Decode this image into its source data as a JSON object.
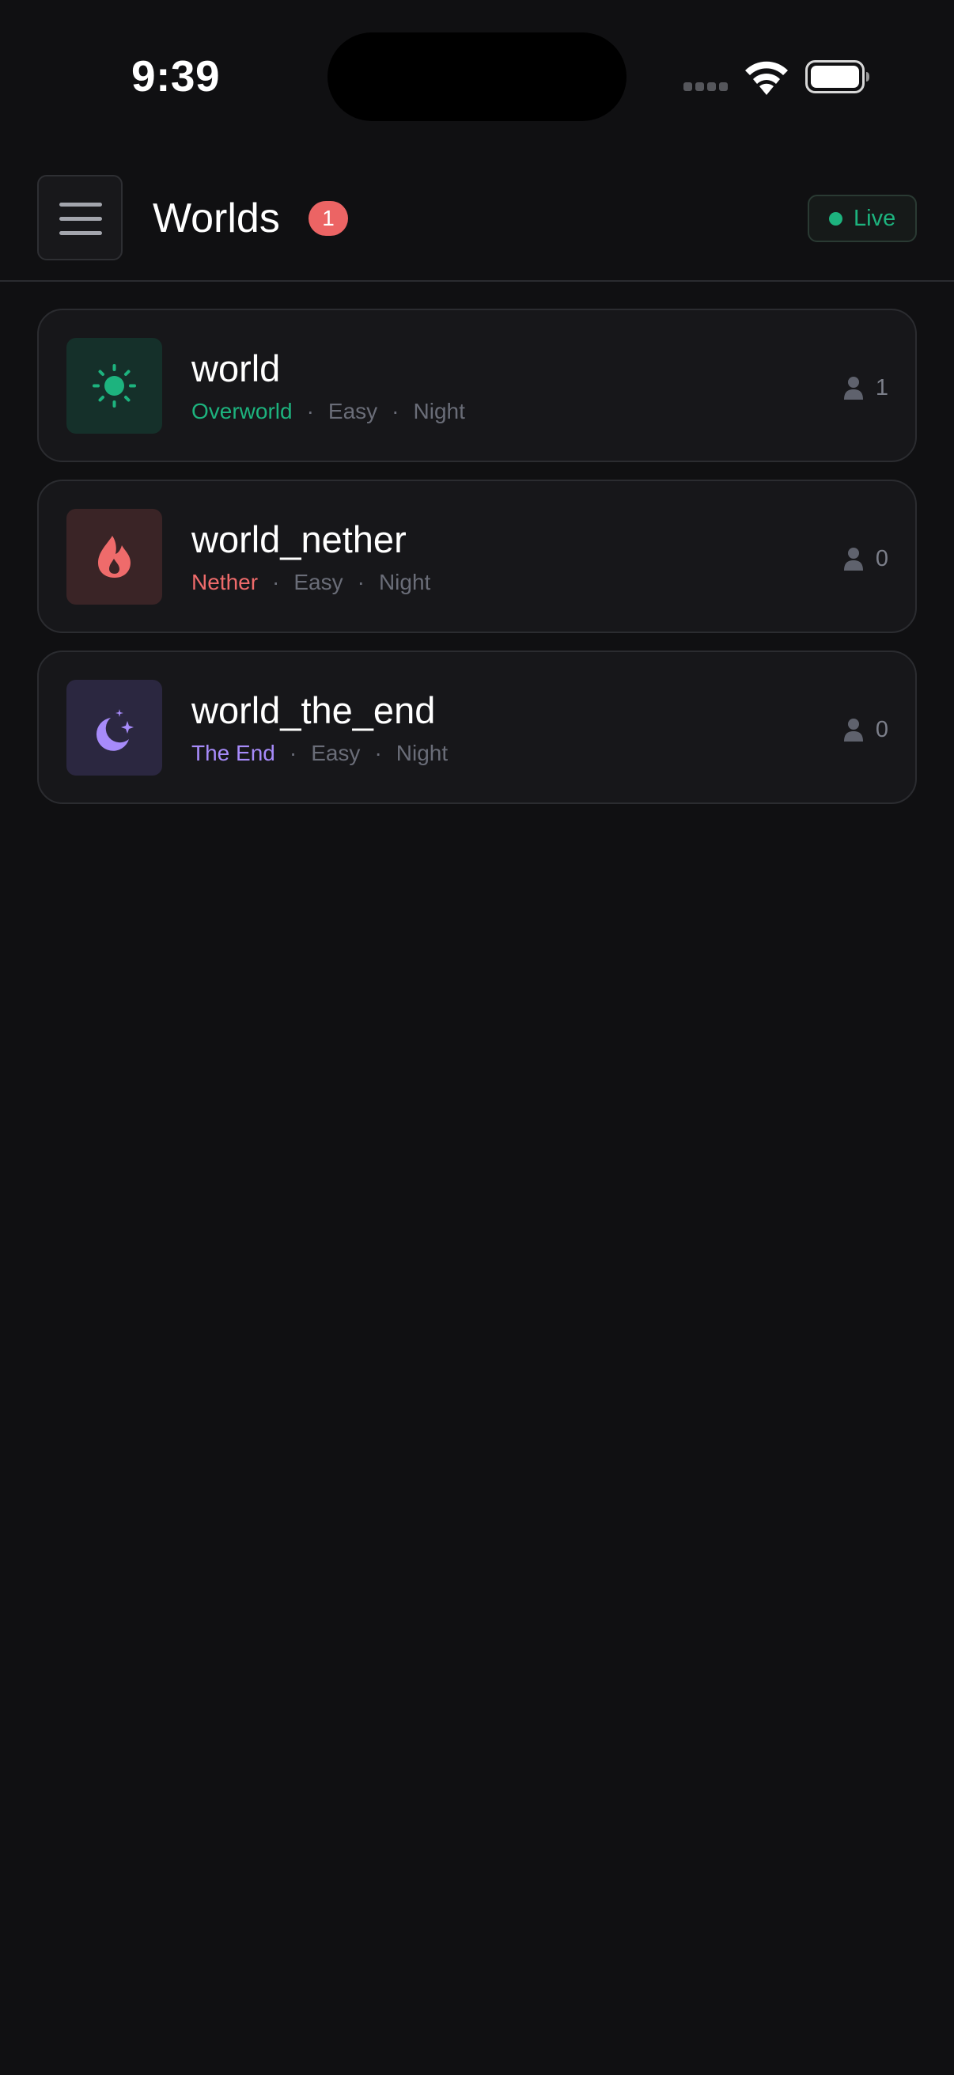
{
  "status_bar": {
    "time": "9:39"
  },
  "header": {
    "title": "Worlds",
    "badge_count": "1",
    "live_label": "Live"
  },
  "colors": {
    "overworld": "#1db37e",
    "nether": "#ef6b6b",
    "the_end": "#a78bfa",
    "live": "#1db37e",
    "badge": "#ec6464"
  },
  "worlds": [
    {
      "name": "world",
      "dimension": "Overworld",
      "difficulty": "Easy",
      "time_of_day": "Night",
      "players": "1",
      "icon": "sun-icon"
    },
    {
      "name": "world_nether",
      "dimension": "Nether",
      "difficulty": "Easy",
      "time_of_day": "Night",
      "players": "0",
      "icon": "flame-icon"
    },
    {
      "name": "world_the_end",
      "dimension": "The End",
      "difficulty": "Easy",
      "time_of_day": "Night",
      "players": "0",
      "icon": "moon-stars-icon"
    }
  ]
}
